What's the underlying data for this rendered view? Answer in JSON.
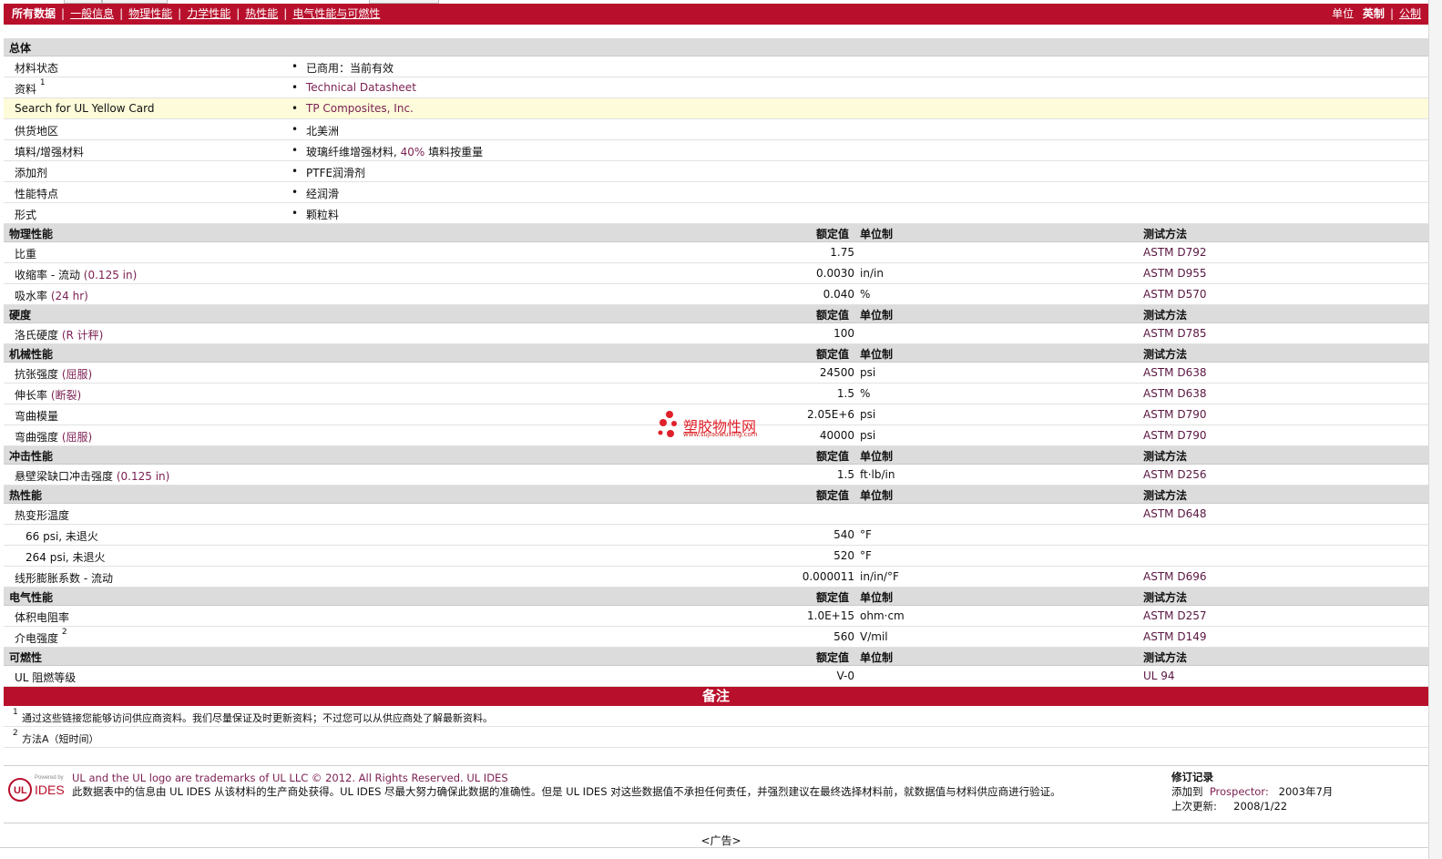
{
  "nav": {
    "all_data": "所有数据",
    "tabs": [
      "一般信息",
      "物理性能",
      "力学性能",
      "热性能",
      "电气性能与可燃性"
    ],
    "units_label": "单位",
    "unit_imperial": "英制",
    "unit_metric": "公制"
  },
  "general": {
    "title": "总体",
    "rows": [
      {
        "label": "材料状态",
        "value": "已商用：当前有效"
      },
      {
        "label": "资料",
        "sup": "1",
        "value": "Technical Datasheet"
      },
      {
        "label": "Search for UL Yellow Card",
        "value": "TP Composites, Inc."
      },
      {
        "label": "供货地区",
        "value": "北美洲"
      },
      {
        "label": "填料/增强材料",
        "value_a": "玻璃纤维增强材料, ",
        "value_b": "40%",
        "value_c": " 填料按重量"
      },
      {
        "label": "添加剂",
        "value": "PTFE润滑剂"
      },
      {
        "label": "性能特点",
        "value": "经润滑"
      },
      {
        "label": "形式",
        "value": "颗粒料"
      }
    ]
  },
  "headers": {
    "nominal": "额定值",
    "unit": "单位制",
    "method": "测试方法"
  },
  "physical": {
    "title": "物理性能",
    "rows": [
      {
        "label": "比重",
        "cond": "",
        "value": "1.75",
        "unit": "",
        "method": "ASTM D792"
      },
      {
        "label": "收缩率 - 流动",
        "cond": "(0.125 in)",
        "value": "0.0030",
        "unit": "in/in",
        "method": "ASTM D955"
      },
      {
        "label": "吸水率",
        "cond": "(24 hr)",
        "value": "0.040",
        "unit": "%",
        "method": "ASTM D570"
      }
    ]
  },
  "hardness": {
    "title": "硬度",
    "rows": [
      {
        "label": "洛氏硬度",
        "cond": "(R 计秤)",
        "value": "100",
        "unit": "",
        "method": "ASTM D785"
      }
    ]
  },
  "mechanical": {
    "title": "机械性能",
    "rows": [
      {
        "label": "抗张强度",
        "cond": "(屈服)",
        "value": "24500",
        "unit": "psi",
        "method": "ASTM D638"
      },
      {
        "label": "伸长率",
        "cond": "(断裂)",
        "value": "1.5",
        "unit": "%",
        "method": "ASTM D638"
      },
      {
        "label": "弯曲模量",
        "cond": "",
        "value": "2.05E+6",
        "unit": "psi",
        "method": "ASTM D790"
      },
      {
        "label": "弯曲强度",
        "cond": "(屈服)",
        "value": "40000",
        "unit": "psi",
        "method": "ASTM D790"
      }
    ]
  },
  "impact": {
    "title": "冲击性能",
    "rows": [
      {
        "label": "悬壁梁缺口冲击强度",
        "cond": "(0.125 in)",
        "value": "1.5",
        "unit": "ft·lb/in",
        "method": "ASTM D256"
      }
    ]
  },
  "thermal": {
    "title": "热性能",
    "rows": [
      {
        "label": "热变形温度",
        "cond": "",
        "value": "",
        "unit": "",
        "method": "ASTM D648"
      },
      {
        "label": "66 psi, 未退火",
        "cond": "",
        "value": "540",
        "unit": "°F",
        "method": ""
      },
      {
        "label": "264 psi, 未退火",
        "cond": "",
        "value": "520",
        "unit": "°F",
        "method": ""
      },
      {
        "label": "线形膨胀系数 - 流动",
        "cond": "",
        "value": "0.000011",
        "unit": "in/in/°F",
        "method": "ASTM D696"
      }
    ]
  },
  "electrical": {
    "title": "电气性能",
    "rows": [
      {
        "label": "体积电阻率",
        "cond": "",
        "value": "1.0E+15",
        "unit": "ohm·cm",
        "method": "ASTM D257"
      },
      {
        "label": "介电强度",
        "sup": "2",
        "cond": "",
        "value": "560",
        "unit": "V/mil",
        "method": "ASTM D149"
      }
    ]
  },
  "flammability": {
    "title": "可燃性",
    "rows": [
      {
        "label": "UL 阻燃等级",
        "cond": "",
        "value": "V-0",
        "unit": "",
        "method": "UL 94"
      }
    ]
  },
  "notes": {
    "title": "备注",
    "items": [
      {
        "num": "1",
        "text": "通过这些链接您能够访问供应商资料。我们尽量保证及时更新资料；不过您可以从供应商处了解最新资料。"
      },
      {
        "num": "2",
        "text": "方法A（短时间）"
      }
    ]
  },
  "footer": {
    "trademark": "UL and the UL logo are trademarks of UL LLC © 2012. All Rights Reserved. UL IDES",
    "disclaimer": "此数据表中的信息由 UL IDES 从该材料的生产商处获得。UL IDES 尽最大努力确保此数据的准确性。但是 UL IDES 对这些数据值不承担任何责任，并强烈建议在最终选择材料前，就数据值与材料供应商进行验证。",
    "logo_powered": "Powered by",
    "logo_text": "IDES",
    "revision_title": "修订记录",
    "added_label": "添加到",
    "added_target": "Prospector:",
    "added_date": "2003年7月",
    "updated_label": "上次更新:",
    "updated_date": "2008/1/22"
  },
  "watermark": {
    "text": "塑胶物性网",
    "url": "www.sujiaowuxing.com"
  },
  "ad": "<广告>"
}
